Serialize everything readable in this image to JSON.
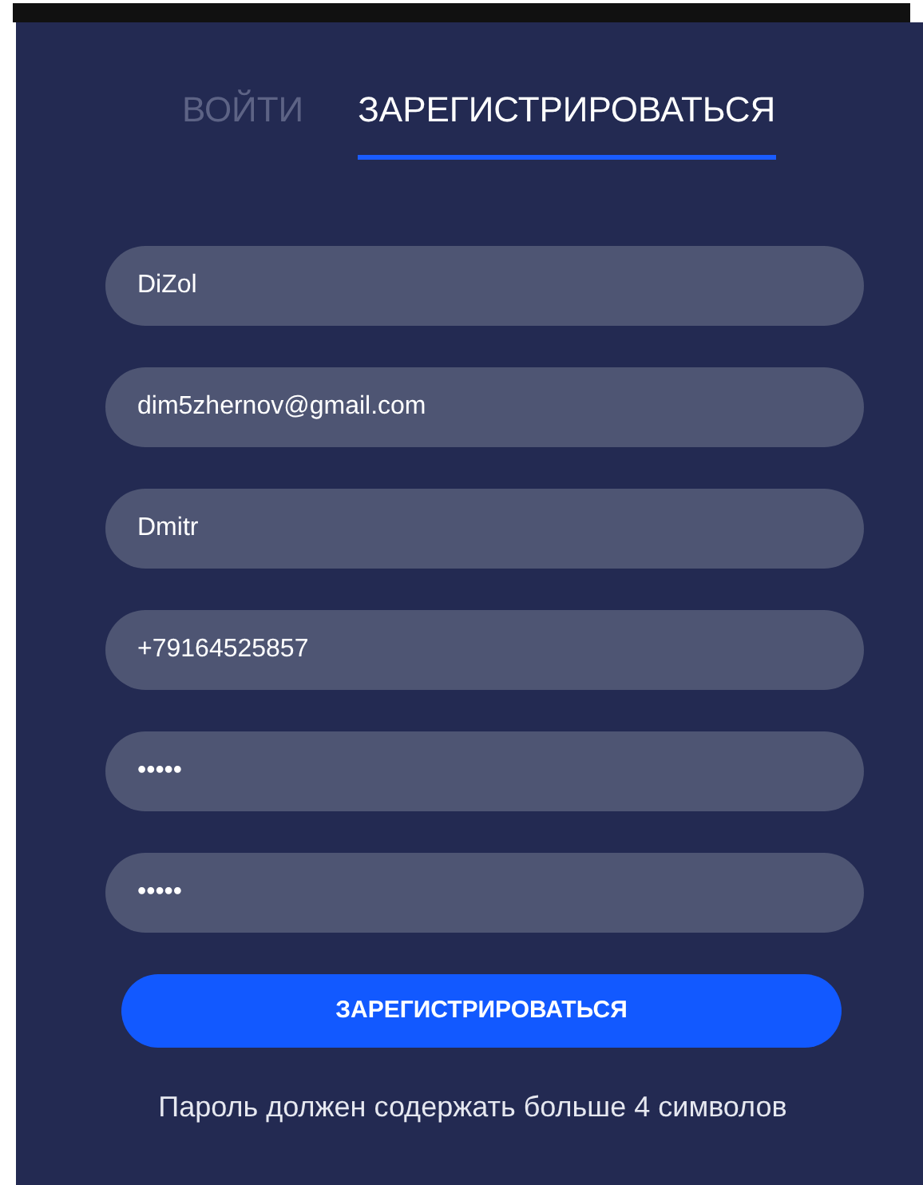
{
  "tabs": [
    {
      "label": "ВОЙТИ",
      "selected": false
    },
    {
      "label": "ЗАРЕГИСТРИРОВАТЬСЯ",
      "selected": true
    }
  ],
  "fields": [
    {
      "value": "DiZol"
    },
    {
      "value": "dim5zhernov@gmail.com"
    },
    {
      "value": "Dmitr"
    },
    {
      "value": "+79164525857"
    },
    {
      "value": "•••••"
    },
    {
      "value": "•••••"
    }
  ],
  "submit_button": "ЗАРЕГИСТРИРОВАТЬСЯ",
  "message": "Пароль должен содержать больше 4 символов"
}
